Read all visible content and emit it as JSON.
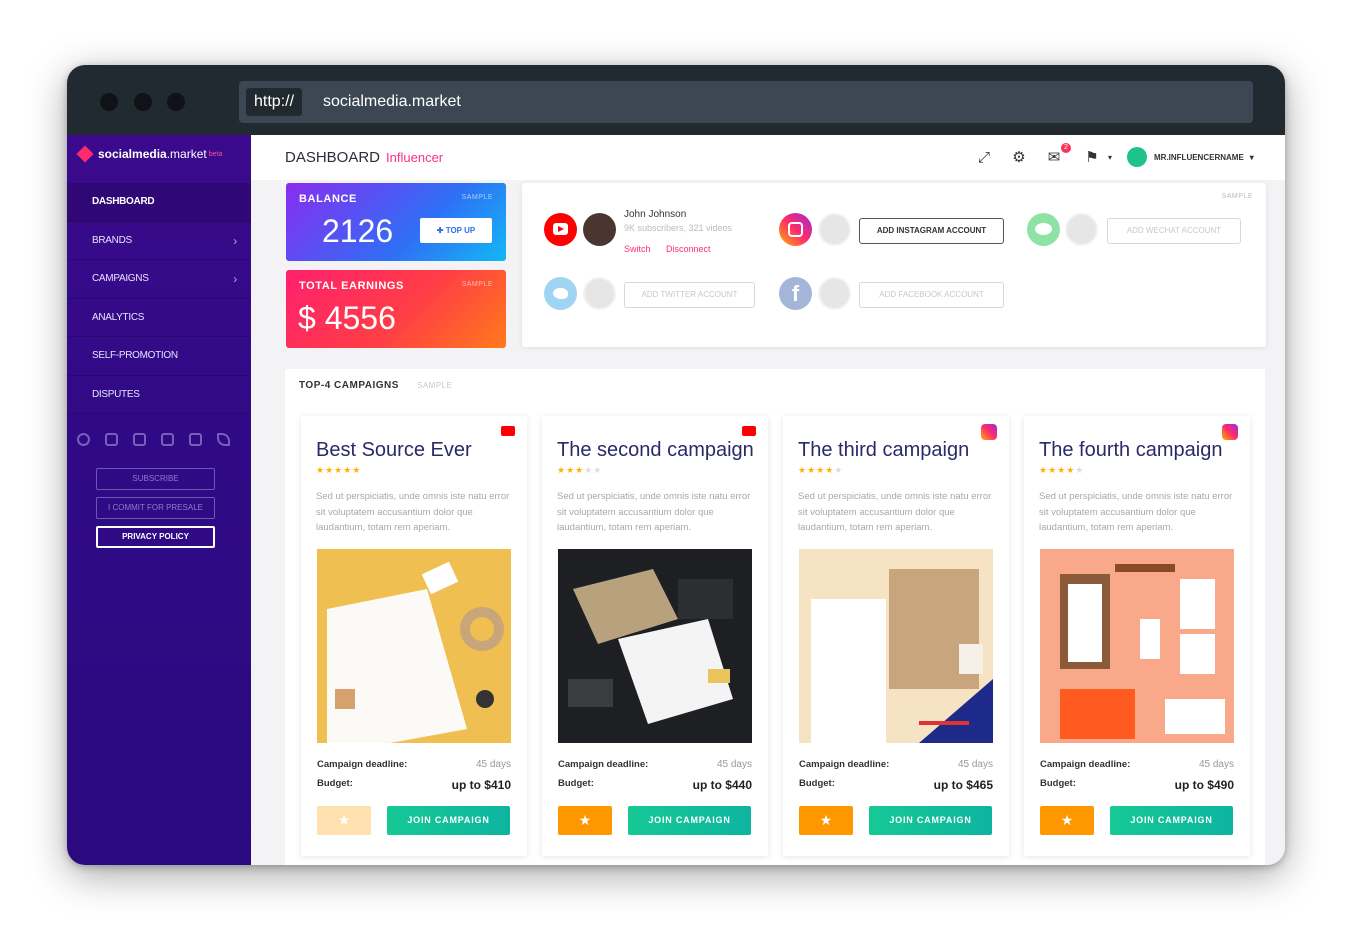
{
  "browser": {
    "protocol": "http://",
    "url": "socialmedia.market",
    "colors": {
      "titlebar": "#222a31",
      "urlbar": "#3b4853"
    }
  },
  "sidebar": {
    "logo": {
      "brand_bold": "socialmedia",
      "brand_thin": ".market",
      "beta": "beta"
    },
    "items": [
      {
        "label": "DASHBOARD",
        "active": true
      },
      {
        "label": "BRANDS",
        "chevron": "›"
      },
      {
        "label": "CAMPAIGNS",
        "chevron": "›"
      },
      {
        "label": "ANALYTICS"
      },
      {
        "label": "SELF-PROMOTION"
      },
      {
        "label": "DISPUTES"
      }
    ],
    "social_icons": [
      "medium-icon",
      "youtube-icon",
      "gmail-icon",
      "instagram-icon",
      "vk-icon",
      "telegram-icon"
    ],
    "buttons": {
      "subscribe": "SUBSCRIBE",
      "presale": "I COMMIT FOR PRESALE",
      "privacy": "PRIVACY POLICY"
    }
  },
  "header": {
    "title": "DASHBOARD",
    "subtitle": "Influencer",
    "notification_count": "2",
    "username": "MR.INFLUENCERNAME",
    "icons": [
      "fullscreen-icon",
      "gear-icon",
      "mail-icon",
      "flag-icon",
      "user-icon"
    ]
  },
  "balance": {
    "label": "BALANCE",
    "sample": "SAMPLE",
    "value": "2126",
    "topup": "✚ TOP UP"
  },
  "earnings": {
    "label": "TOTAL EARNINGS",
    "sample": "SAMPLE",
    "value": "$ 4556"
  },
  "accounts": {
    "sample": "SAMPLE",
    "youtube": {
      "name": "John Johnson",
      "stats": "9K subscribers, 321 videos",
      "switch": "Switch",
      "disconnect": "Disconnect"
    },
    "instagram_button": "ADD INSTAGRAM ACCOUNT",
    "wechat_button": "ADD WECHAT ACCOUNT",
    "twitter_button": "ADD TWITTER ACCOUNT",
    "facebook_button": "ADD FACEBOOK ACCOUNT"
  },
  "campaigns": {
    "title": "TOP-4 CAMPAIGNS",
    "sample": "SAMPLE",
    "deadline_label": "Campaign deadline:",
    "budget_label": "Budget:",
    "join_label": "JOIN CAMPAIGN",
    "star_glyph": "★",
    "items": [
      {
        "title": "Best Source Ever",
        "stars": "★★★★★",
        "stars_off": "",
        "rating": 5,
        "platform": "youtube",
        "desc": "Sed ut perspiciatis, unde omnis iste natu error sit voluptatem accusantium dolor que laudantium, totam rem aperiam.",
        "deadline": "45 days",
        "budget": "up to $410",
        "favorited": false
      },
      {
        "title": "The second campaign",
        "stars": "★★★",
        "stars_off": "★★",
        "rating": 3,
        "platform": "youtube",
        "desc": "Sed ut perspiciatis, unde omnis iste natu error sit voluptatem accusantium dolor que laudantium, totam rem aperiam.",
        "deadline": "45 days",
        "budget": "up to $440",
        "favorited": true
      },
      {
        "title": "The third campaign",
        "stars": "★★★★",
        "stars_off": "★",
        "rating": 4,
        "platform": "instagram",
        "desc": "Sed ut perspiciatis, unde omnis iste natu error sit voluptatem accusantium dolor que laudantium, totam rem aperiam.",
        "deadline": "45 days",
        "budget": "up to $465",
        "favorited": true
      },
      {
        "title": "The fourth campaign",
        "stars": "★★★★",
        "stars_off": "★",
        "rating": 4,
        "platform": "instagram",
        "desc": "Sed ut perspiciatis, unde omnis iste natu error sit voluptatem accusantium dolor que laudantium, totam rem aperiam.",
        "deadline": "45 days",
        "budget": "up to $490",
        "favorited": true
      }
    ]
  },
  "colors": {
    "accent_pink": "#ff2f8a",
    "sidebar": "#300a86",
    "join_green": "#16c995",
    "star_orange": "#ff9800"
  }
}
